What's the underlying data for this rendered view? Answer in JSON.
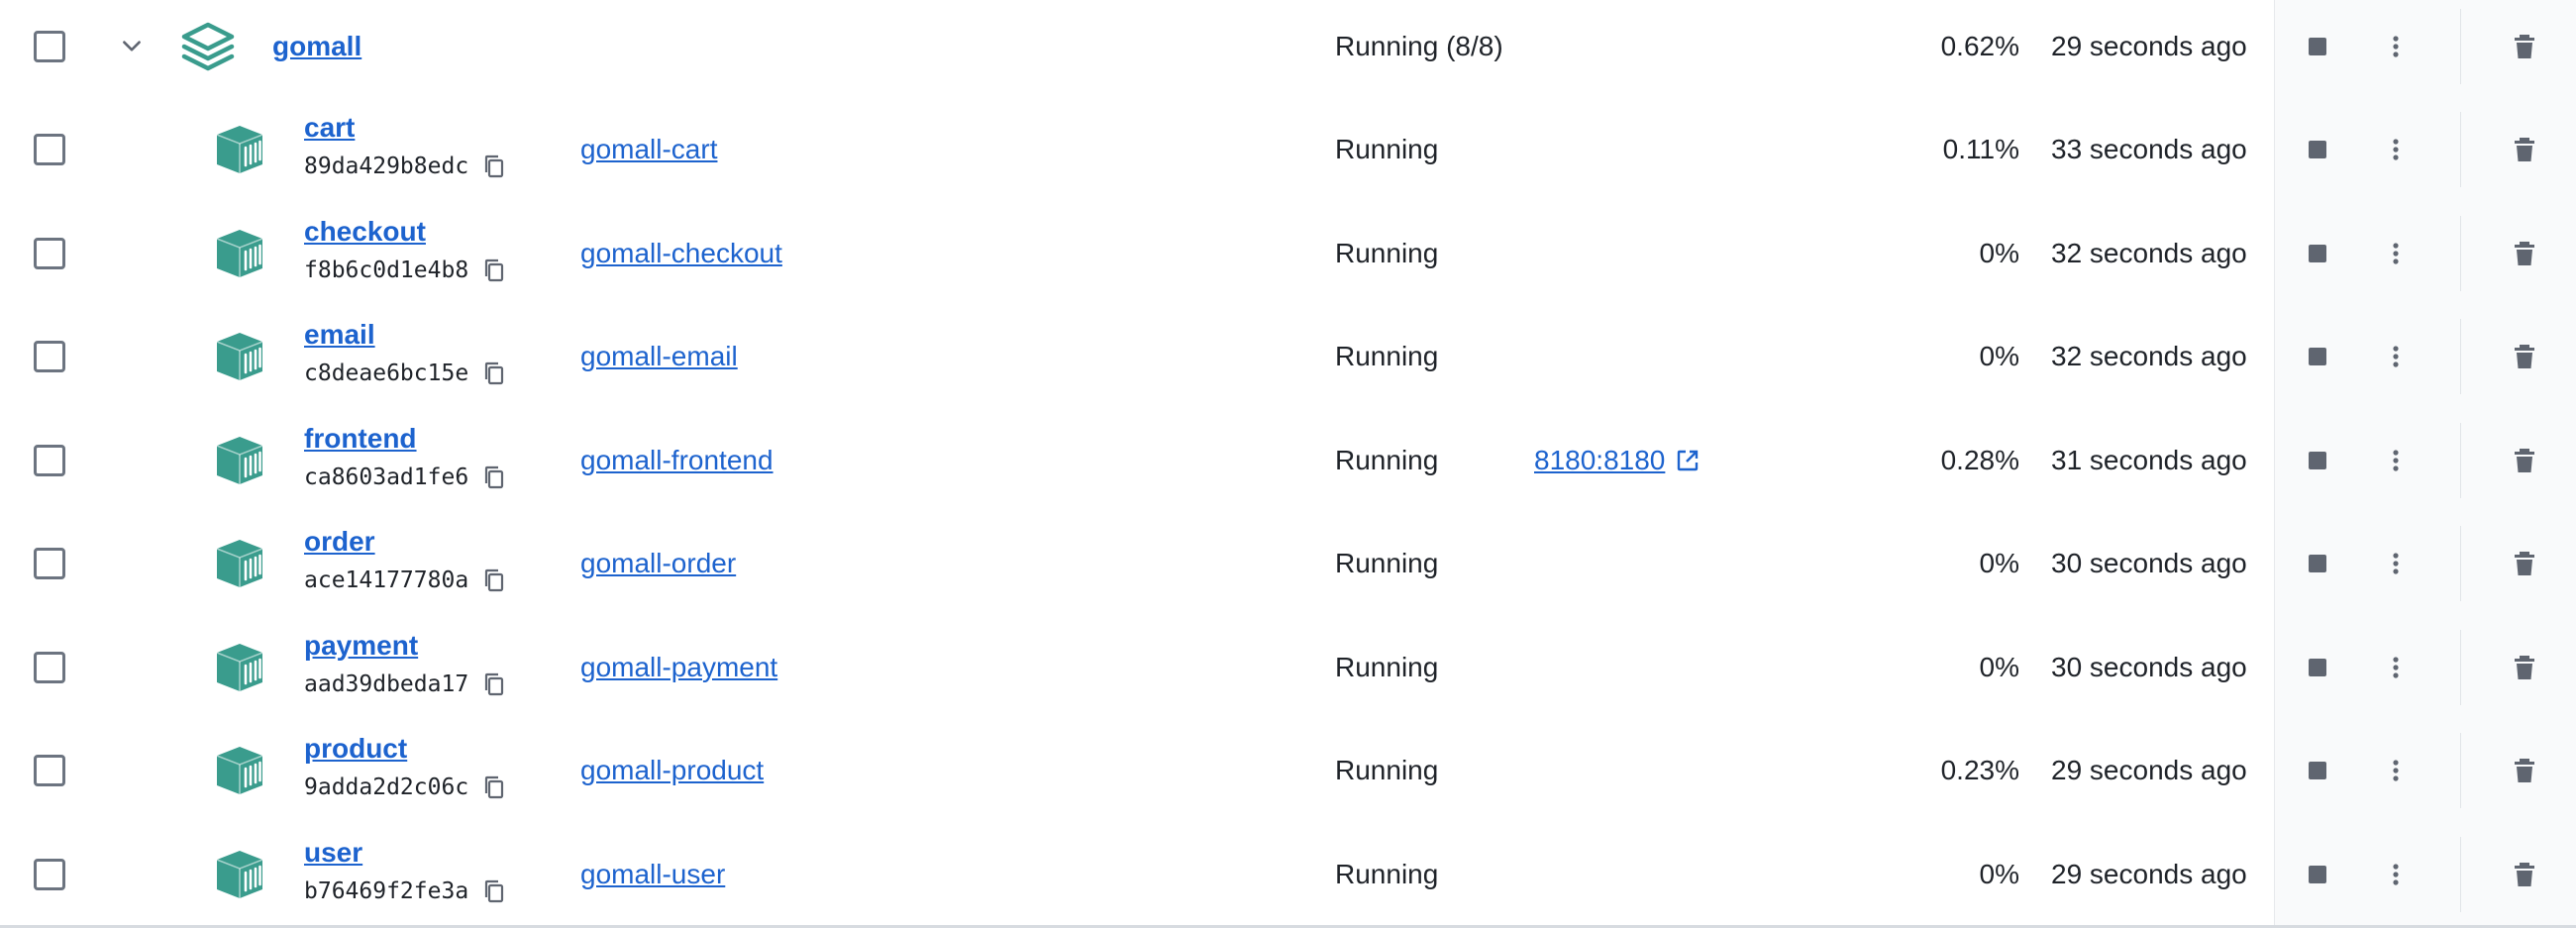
{
  "colors": {
    "accent": "#3a9c8d",
    "link": "#1d63ce",
    "text": "#1f2329",
    "icon": "#5f6570"
  },
  "group": {
    "name": "gomall",
    "status": "Running (8/8)",
    "cpu": "0.62%",
    "started": "29 seconds ago"
  },
  "containers": [
    {
      "name": "cart",
      "id": "89da429b8edc",
      "image": "gomall-cart",
      "status": "Running",
      "port": "",
      "cpu": "0.11%",
      "started": "33 seconds ago"
    },
    {
      "name": "checkout",
      "id": "f8b6c0d1e4b8",
      "image": "gomall-checkout",
      "status": "Running",
      "port": "",
      "cpu": "0%",
      "started": "32 seconds ago"
    },
    {
      "name": "email",
      "id": "c8deae6bc15e",
      "image": "gomall-email",
      "status": "Running",
      "port": "",
      "cpu": "0%",
      "started": "32 seconds ago"
    },
    {
      "name": "frontend",
      "id": "ca8603ad1fe6",
      "image": "gomall-frontend",
      "status": "Running",
      "port": "8180:8180",
      "cpu": "0.28%",
      "started": "31 seconds ago"
    },
    {
      "name": "order",
      "id": "ace14177780a",
      "image": "gomall-order",
      "status": "Running",
      "port": "",
      "cpu": "0%",
      "started": "30 seconds ago"
    },
    {
      "name": "payment",
      "id": "aad39dbeda17",
      "image": "gomall-payment",
      "status": "Running",
      "port": "",
      "cpu": "0%",
      "started": "30 seconds ago"
    },
    {
      "name": "product",
      "id": "9adda2d2c06c",
      "image": "gomall-product",
      "status": "Running",
      "port": "",
      "cpu": "0.23%",
      "started": "29 seconds ago"
    },
    {
      "name": "user",
      "id": "b76469f2fe3a",
      "image": "gomall-user",
      "status": "Running",
      "port": "",
      "cpu": "0%",
      "started": "29 seconds ago"
    }
  ],
  "icons": {
    "expand": "chevron-down-icon",
    "group": "stack-icon",
    "container": "container-icon",
    "copy": "copy-icon",
    "port_link": "external-link-icon",
    "stop": "stop-icon",
    "more": "more-vertical-icon",
    "delete": "trash-icon"
  }
}
